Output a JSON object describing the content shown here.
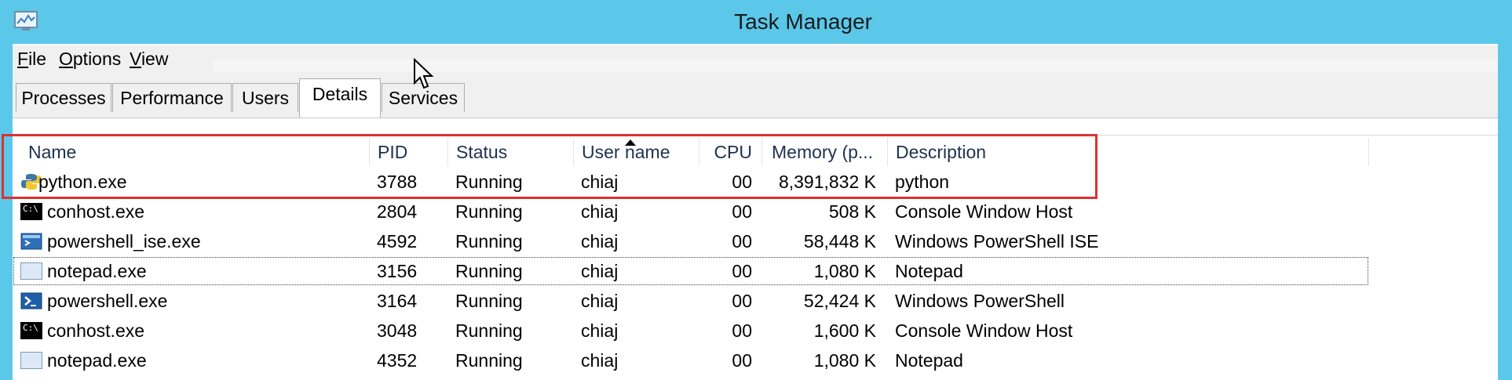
{
  "window": {
    "title": "Task Manager"
  },
  "menu": [
    {
      "label": "File",
      "accel": "F",
      "rest": "ile"
    },
    {
      "label": "Options",
      "accel": "O",
      "rest": "ptions"
    },
    {
      "label": "View",
      "accel": "V",
      "rest": "iew"
    }
  ],
  "tabs": [
    "Processes",
    "Performance",
    "Users",
    "Details",
    "Services"
  ],
  "active_tab": "Details",
  "columns": {
    "name": "Name",
    "pid": "PID",
    "status": "Status",
    "user": "User name",
    "cpu": "CPU",
    "memory": "Memory (p...",
    "description": "Description"
  },
  "sorted_column": "User name",
  "rows": [
    {
      "icon": "python-icon",
      "name": "python.exe",
      "pid": "3788",
      "status": "Running",
      "user": "chiaj",
      "cpu": "00",
      "memory": "8,391,832 K",
      "description": "python"
    },
    {
      "icon": "console-icon",
      "name": "conhost.exe",
      "pid": "2804",
      "status": "Running",
      "user": "chiaj",
      "cpu": "00",
      "memory": "508 K",
      "description": "Console Window Host"
    },
    {
      "icon": "powershell-ise-icon",
      "name": "powershell_ise.exe",
      "pid": "4592",
      "status": "Running",
      "user": "chiaj",
      "cpu": "00",
      "memory": "58,448 K",
      "description": "Windows PowerShell ISE"
    },
    {
      "icon": "notepad-icon",
      "name": "notepad.exe",
      "pid": "3156",
      "status": "Running",
      "user": "chiaj",
      "cpu": "00",
      "memory": "1,080 K",
      "description": "Notepad"
    },
    {
      "icon": "powershell-icon",
      "name": "powershell.exe",
      "pid": "3164",
      "status": "Running",
      "user": "chiaj",
      "cpu": "00",
      "memory": "52,424 K",
      "description": "Windows PowerShell"
    },
    {
      "icon": "console-icon",
      "name": "conhost.exe",
      "pid": "3048",
      "status": "Running",
      "user": "chiaj",
      "cpu": "00",
      "memory": "1,600 K",
      "description": "Console Window Host"
    },
    {
      "icon": "notepad-icon",
      "name": "notepad.exe",
      "pid": "4352",
      "status": "Running",
      "user": "chiaj",
      "cpu": "00",
      "memory": "1,080 K",
      "description": "Notepad"
    }
  ],
  "focused_row": "notepad.exe (3156)",
  "colors": {
    "titlebar": "#5bc8ea",
    "annotation": "#e03030"
  }
}
